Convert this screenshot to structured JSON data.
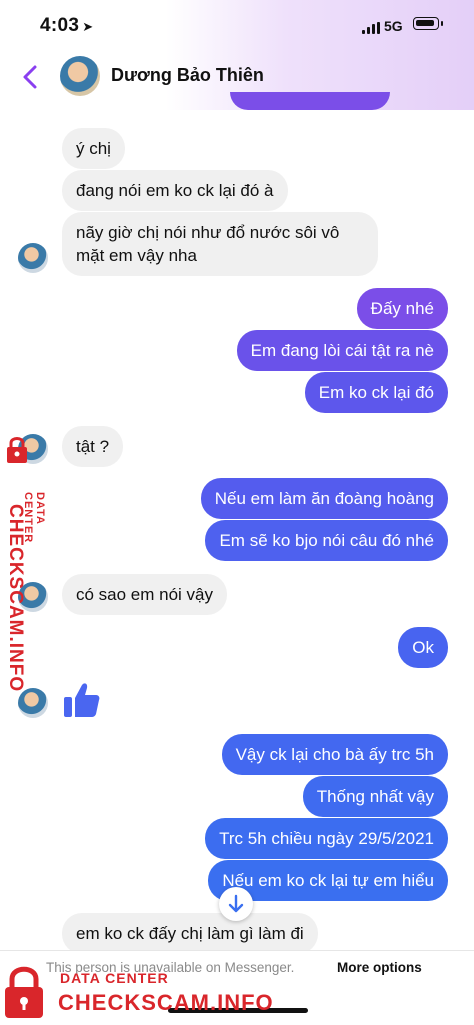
{
  "status": {
    "time": "4:03",
    "network": "5G"
  },
  "header": {
    "name": "Dương Bảo Thiên"
  },
  "colors": {
    "outgoing_top": "#7b4ee8",
    "outgoing_bottom": "#3a6ff0",
    "incoming": "#f0f0f0",
    "watermark": "#d9262b"
  },
  "messages": [
    {
      "text": "ý chị",
      "dir": "in"
    },
    {
      "text": "đang nói em ko ck lại đó à",
      "dir": "in"
    },
    {
      "text_line1": "nãy giờ chị nói như đổ nước sôi vô",
      "text_line2": "mặt em vậy nha",
      "dir": "in"
    },
    {
      "text": "Đấy nhé",
      "dir": "out"
    },
    {
      "text": "Em đang lòi cái tật ra nè",
      "dir": "out"
    },
    {
      "text": "Em ko ck lại đó",
      "dir": "out"
    },
    {
      "text": "tật ?",
      "dir": "in"
    },
    {
      "text": "Nếu em làm ăn đoàng hoàng",
      "dir": "out"
    },
    {
      "text": "Em sẽ ko bjo nói câu đó nhé",
      "dir": "out"
    },
    {
      "text": "có sao em nói vậy",
      "dir": "in"
    },
    {
      "text": "Ok",
      "dir": "out"
    },
    {
      "text": "Vậy ck lại cho bà ấy trc 5h",
      "dir": "out"
    },
    {
      "text": "Thống nhất vậy",
      "dir": "out"
    },
    {
      "text": "Trc 5h chiều ngày 29/5/2021",
      "dir": "out"
    },
    {
      "text": "Nếu em ko ck lại tự em hiểu",
      "dir": "out"
    },
    {
      "text": "em ko ck đấy chị làm gì làm đi",
      "dir": "in"
    }
  ],
  "footer": {
    "unavailable": "This person is unavailable on Messenger.",
    "more_options": "More options"
  },
  "watermark": {
    "sub": "DATA CENTER",
    "main": "CHECKSCAM.INFO"
  }
}
